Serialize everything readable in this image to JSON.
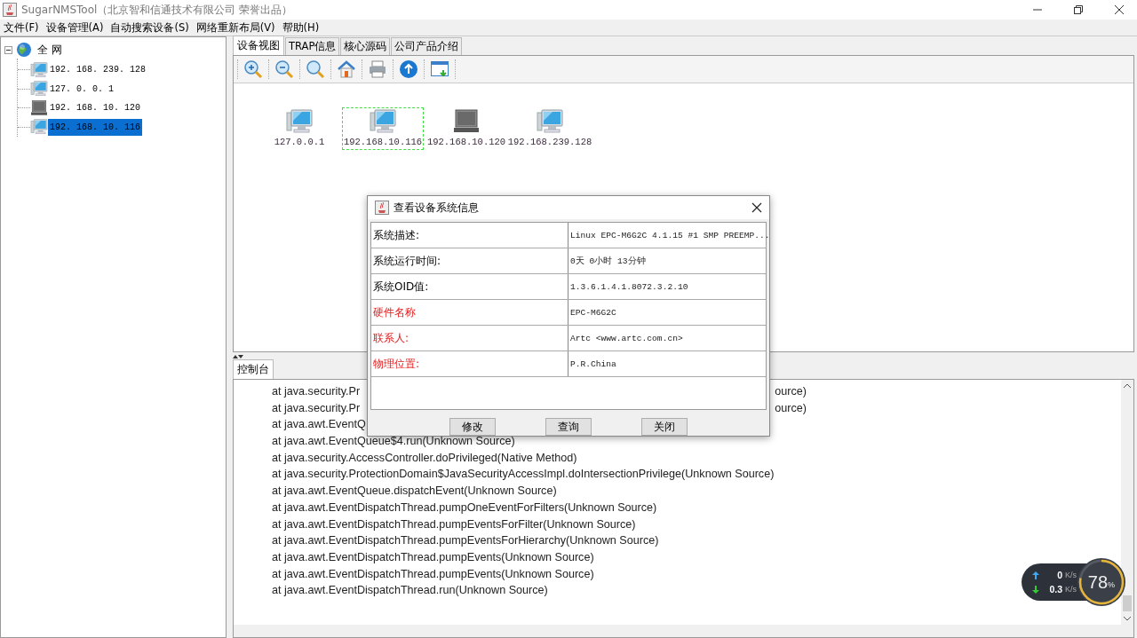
{
  "window": {
    "title": "SugarNMSTool（北京智和信通技术有限公司 荣誉出品）"
  },
  "menu": [
    "文件(F)",
    "设备管理(A)",
    "自动搜索设备(S)",
    "网络重新布局(V)",
    "帮助(H)"
  ],
  "tree": {
    "label": "全 网",
    "expanded": true,
    "children": [
      {
        "label": "192. 168. 239. 128",
        "online": true,
        "selected": false
      },
      {
        "label": "127. 0. 0. 1",
        "online": true,
        "selected": false
      },
      {
        "label": "192. 168. 10. 120",
        "online": false,
        "selected": false
      },
      {
        "label": "192. 168. 10. 116",
        "online": true,
        "selected": true
      }
    ]
  },
  "tabs": [
    {
      "label": "设备视图",
      "selected": true
    },
    {
      "label": "TRAP信息",
      "selected": false
    },
    {
      "label": "核心源码",
      "selected": false
    },
    {
      "label": "公司产品介绍",
      "selected": false
    }
  ],
  "devices": [
    {
      "label": "127.0.0.1",
      "online": true,
      "selected": false
    },
    {
      "label": "192.168.10.116",
      "online": true,
      "selected": true
    },
    {
      "label": "192.168.10.120",
      "online": false,
      "selected": false
    },
    {
      "label": "192.168.239.128",
      "online": true,
      "selected": false
    }
  ],
  "console": {
    "tab": "控制台",
    "lines": [
      {
        "left": "at java.security.Pr",
        "right": "ource)"
      },
      {
        "left": "at java.security.Pr",
        "right": "ource)"
      },
      {
        "left": "at java.awt.EventQ"
      },
      {
        "left": "at java.awt.EventQueue$4.run(Unknown Source)"
      },
      {
        "left": "at java.security.AccessController.doPrivileged(Native Method)"
      },
      {
        "left": "at java.security.ProtectionDomain$JavaSecurityAccessImpl.doIntersectionPrivilege(Unknown Source)"
      },
      {
        "left": "at java.awt.EventQueue.dispatchEvent(Unknown Source)"
      },
      {
        "left": "at java.awt.EventDispatchThread.pumpOneEventForFilters(Unknown Source)"
      },
      {
        "left": "at java.awt.EventDispatchThread.pumpEventsForFilter(Unknown Source)"
      },
      {
        "left": "at java.awt.EventDispatchThread.pumpEventsForHierarchy(Unknown Source)"
      },
      {
        "left": "at java.awt.EventDispatchThread.pumpEvents(Unknown Source)"
      },
      {
        "left": "at java.awt.EventDispatchThread.pumpEvents(Unknown Source)"
      },
      {
        "left": "at java.awt.EventDispatchThread.run(Unknown Source)"
      }
    ]
  },
  "dialog": {
    "title": "查看设备系统信息",
    "rows": [
      {
        "label": "系统描述:",
        "value": "Linux EPC-M6G2C 4.1.15 #1 SMP PREEMP...",
        "emphasized": false
      },
      {
        "label": "系统运行时间:",
        "value": "0天 0小时 13分钟",
        "emphasized": false
      },
      {
        "label": "系统OID值:",
        "value": "1.3.6.1.4.1.8072.3.2.10",
        "emphasized": false
      },
      {
        "label": "硬件名称",
        "value": "EPC-M6G2C",
        "emphasized": true
      },
      {
        "label": "联系人:",
        "value": "Artc <www.artc.com.cn>",
        "emphasized": true
      },
      {
        "label": "物理位置:",
        "value": "P.R.China",
        "emphasized": true
      }
    ],
    "buttons": [
      "修改",
      "查询",
      "关闭"
    ]
  },
  "net_widget": {
    "upload": "0",
    "upload_unit": "K/s",
    "download": "0.3",
    "download_unit": "K/s",
    "percent": "78",
    "percent_sign": "%"
  }
}
